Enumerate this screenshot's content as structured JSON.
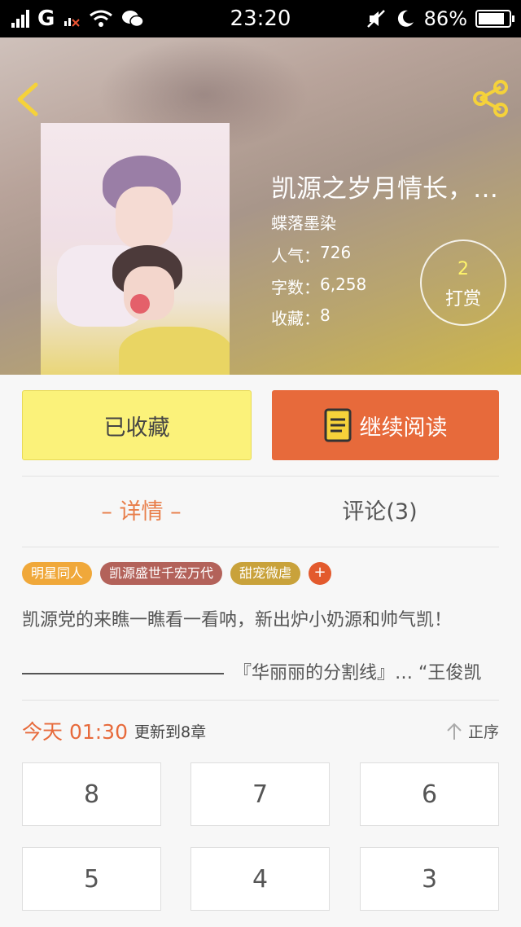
{
  "status_bar": {
    "network": "G",
    "time": "23:20",
    "battery_percent": "86%",
    "battery_level": 0.86
  },
  "book": {
    "title": "凯源之岁月情长，…",
    "author": "蝶落墨染",
    "popularity_label": "人气：",
    "popularity_value": "726",
    "wordcount_label": "字数：",
    "wordcount_value": "6,258",
    "favorites_label": "收藏：",
    "favorites_value": "8"
  },
  "reward": {
    "count": "2",
    "label": "打赏"
  },
  "actions": {
    "favorite_label": "已收藏",
    "read_label": "继续阅读"
  },
  "tabs": {
    "detail": "– 详情 –",
    "comments": "评论(3)"
  },
  "tags": [
    {
      "label": "明星同人",
      "color": "#f0a83a"
    },
    {
      "label": "凯源盛世千宏万代",
      "color": "#b3625a"
    },
    {
      "label": "甜宠微虐",
      "color": "#c9a23b"
    }
  ],
  "tag_add": "+",
  "summary": {
    "line1": "凯源党的来瞧一瞧看一看呐，新出炉小奶源和帅气凯！",
    "line2": "『华丽丽的分割线』… “王俊凯"
  },
  "update": {
    "today": "今天 01:30",
    "info": "更新到8章",
    "sort_label": "正序"
  },
  "chapters": [
    "8",
    "7",
    "6",
    "5",
    "4",
    "3"
  ],
  "colors": {
    "accent": "#e76a3b",
    "favorite_bg": "#fbf27a",
    "reward_number": "#fff46a"
  }
}
